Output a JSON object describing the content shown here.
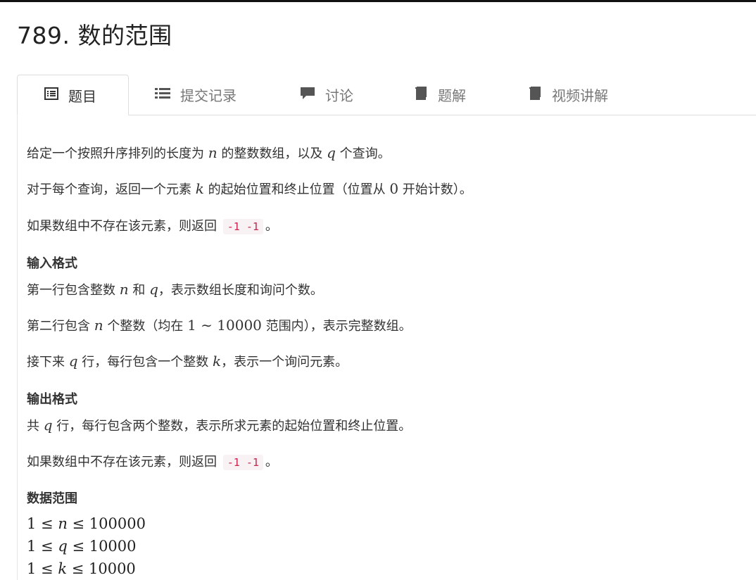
{
  "title": "789. 数的范围",
  "tabs": [
    {
      "label": "题目",
      "icon": "list-alt-icon"
    },
    {
      "label": "提交记录",
      "icon": "list-icon"
    },
    {
      "label": "讨论",
      "icon": "comment-icon"
    },
    {
      "label": "题解",
      "icon": "book-icon"
    },
    {
      "label": "视频讲解",
      "icon": "book-icon"
    }
  ],
  "problem": {
    "p1": {
      "a": "给定一个按照升序排列的长度为 ",
      "n": "n",
      "b": " 的整数数组，以及 ",
      "q": "q",
      "c": " 个查询。"
    },
    "p2": {
      "a": "对于每个查询，返回一个元素 ",
      "k": "k",
      "b": " 的起始位置和终止位置（位置从 ",
      "zero": "0",
      "c": " 开始计数）。"
    },
    "p3": {
      "a": "如果数组中不存在该元素，则返回 ",
      "code": "-1 -1",
      "b": "。"
    },
    "input_heading": "输入格式",
    "in1": {
      "a": "第一行包含整数 ",
      "n": "n",
      "b": " 和 ",
      "q": "q",
      "c": "，表示数组长度和询问个数。"
    },
    "in2": {
      "a": "第二行包含 ",
      "n": "n",
      "b": " 个整数（均在 ",
      "range": "1 ∼ 10000",
      "c": " 范围内），表示完整数组。"
    },
    "in3": {
      "a": "接下来 ",
      "q": "q",
      "b": " 行，每行包含一个整数 ",
      "k": "k",
      "c": "，表示一个询问元素。"
    },
    "output_heading": "输出格式",
    "out1": {
      "a": "共 ",
      "q": "q",
      "b": " 行，每行包含两个整数，表示所求元素的起始位置和终止位置。"
    },
    "out2": {
      "a": "如果数组中不存在该元素，则返回 ",
      "code": "-1 -1",
      "b": "。"
    },
    "range_heading": "数据范围",
    "ranges": [
      {
        "lhs": "1 ≤ ",
        "var": "n",
        "rhs": " ≤ 100000"
      },
      {
        "lhs": "1 ≤ ",
        "var": "q",
        "rhs": " ≤ 10000"
      },
      {
        "lhs": "1 ≤ ",
        "var": "k",
        "rhs": " ≤ 10000"
      }
    ]
  },
  "colors": {
    "code_text": "#c7254e",
    "code_bg": "#f9f2f4"
  }
}
